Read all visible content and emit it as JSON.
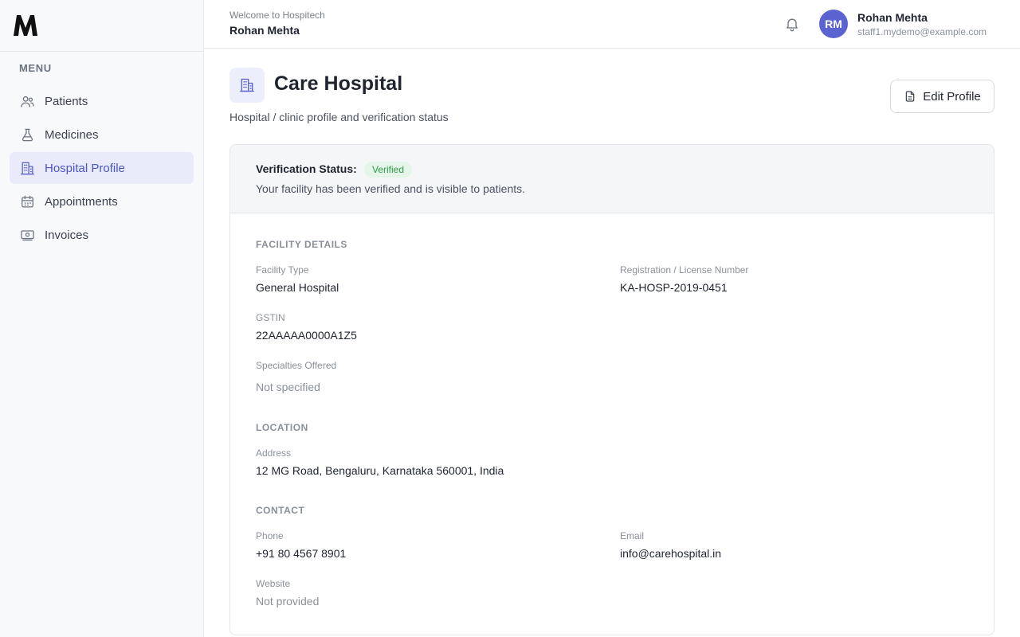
{
  "app": {
    "logo_text": "M"
  },
  "sidebar": {
    "menu_heading": "MENU",
    "items": [
      {
        "label": "Patients",
        "icon": "users-icon"
      },
      {
        "label": "Medicines",
        "icon": "flask-icon"
      },
      {
        "label": "Hospital Profile",
        "icon": "building-icon",
        "active": true
      },
      {
        "label": "Appointments",
        "icon": "calendar-icon"
      },
      {
        "label": "Invoices",
        "icon": "banknote-icon"
      }
    ]
  },
  "header": {
    "welcome": "Welcome to Hospitech",
    "name": "Rohan Mehta",
    "user": {
      "initials": "RM",
      "name": "Rohan Mehta",
      "email": "staff1.mydemo@example.com"
    }
  },
  "page": {
    "title": "Care Hospital",
    "subtitle": "Hospital / clinic profile and verification status",
    "edit_button": "Edit Profile"
  },
  "verification": {
    "label": "Verification Status:",
    "badge": "Verified",
    "message": "Your facility has been verified and is visible to patients."
  },
  "facility": {
    "heading": "FACILITY DETAILS",
    "type_label": "Facility Type",
    "type_value": "General Hospital",
    "reg_label": "Registration / License Number",
    "reg_value": "KA-HOSP-2019-0451",
    "gstin_label": "GSTIN",
    "gstin_value": "22AAAAA0000A1Z5",
    "specialties_label": "Specialties Offered",
    "specialties_value": "Not specified"
  },
  "location": {
    "heading": "LOCATION",
    "address_label": "Address",
    "address_value": "12 MG Road, Bengaluru, Karnataka 560001, India"
  },
  "contact": {
    "heading": "CONTACT",
    "phone_label": "Phone",
    "phone_value": "+91 80 4567 8901",
    "email_label": "Email",
    "email_value": "info@carehospital.in",
    "website_label": "Website",
    "website_value": "Not provided"
  },
  "colors": {
    "accent": "#5861cc",
    "active_bg": "#e9ebfa",
    "verified_bg": "#e6f5ea",
    "verified_text": "#2e9b4b"
  }
}
